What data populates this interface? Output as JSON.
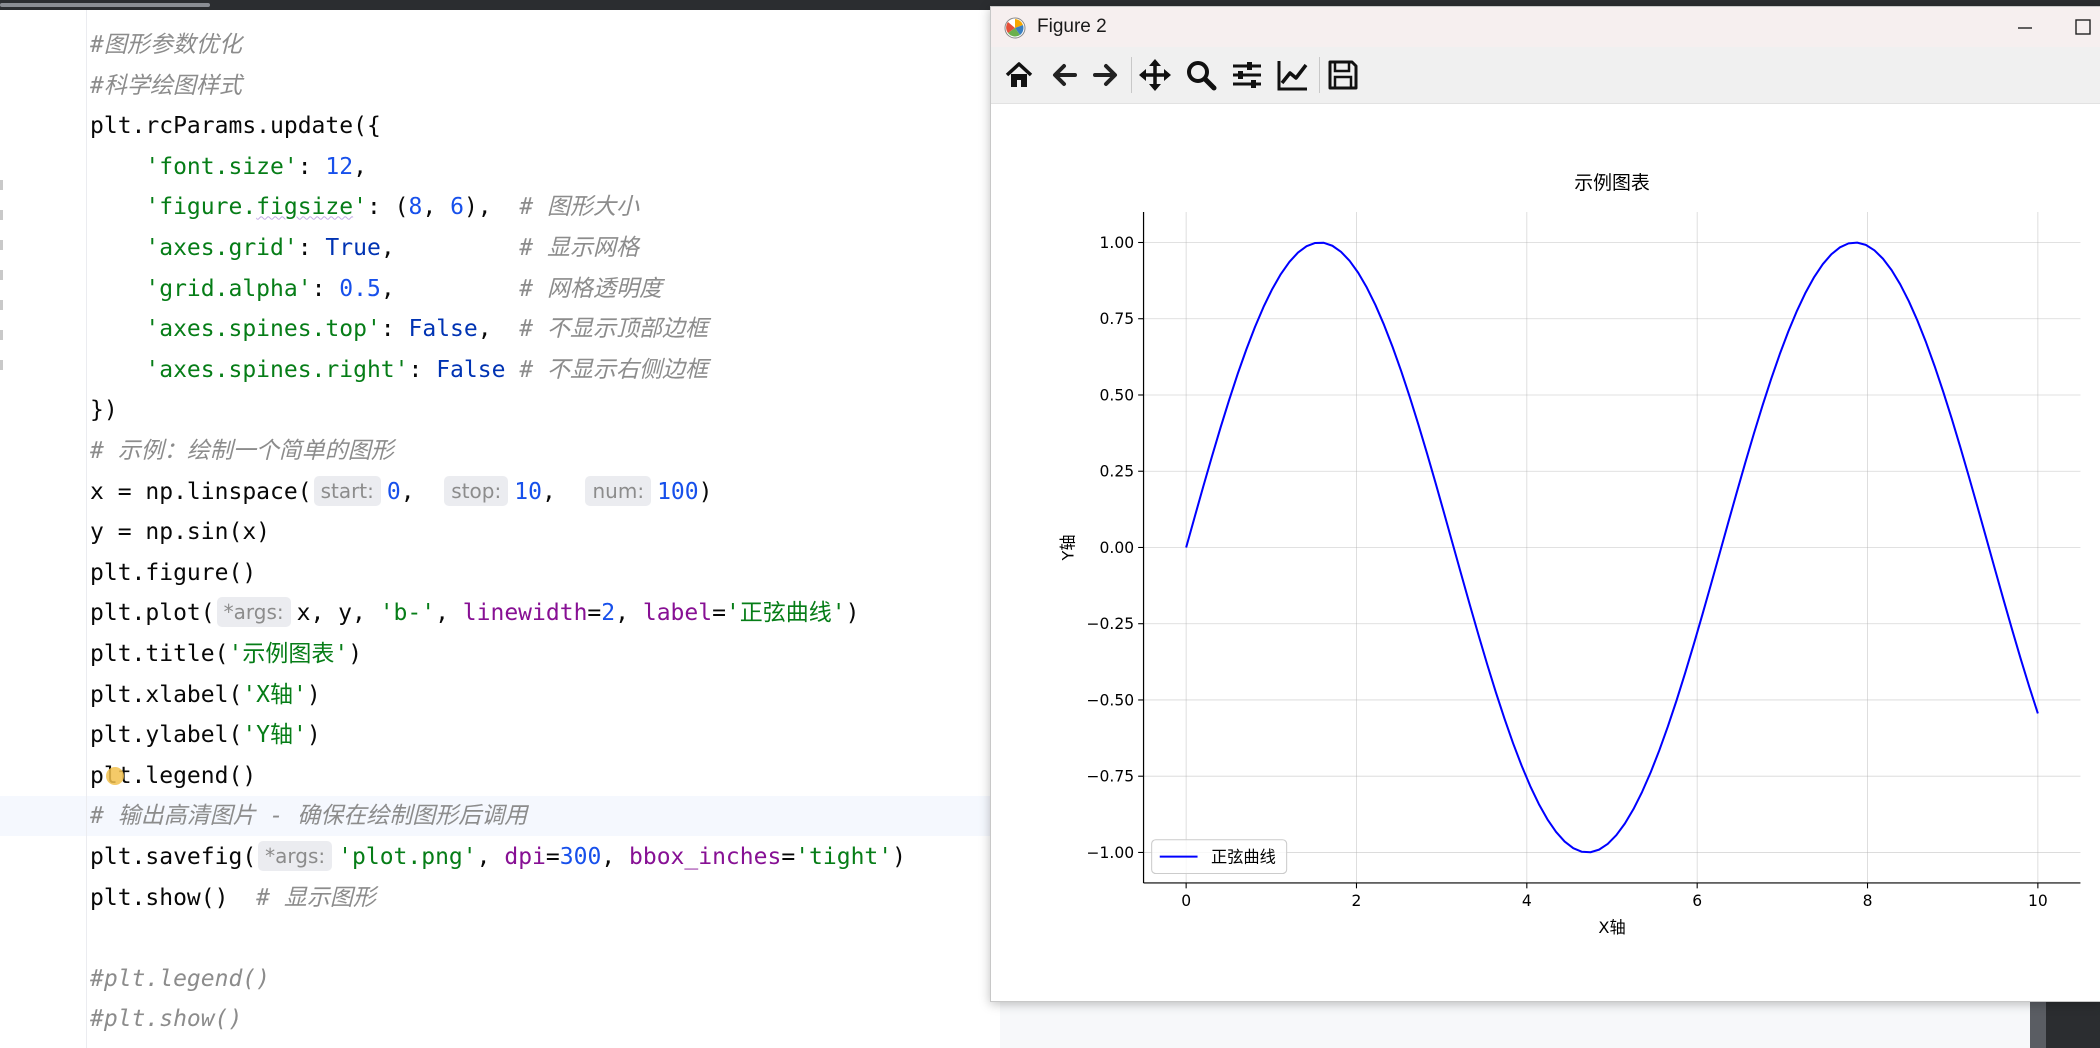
{
  "editor": {
    "code": [
      [
        {
          "t": "#图形参数优化",
          "c": "comment"
        }
      ],
      [
        {
          "t": "#科学绘图样式",
          "c": "comment"
        }
      ],
      [
        {
          "t": "plt.rcParams.update({",
          "c": "plain"
        }
      ],
      [
        {
          "t": "    ",
          "c": "plain"
        },
        {
          "t": "'font.size'",
          "c": "str"
        },
        {
          "t": ": ",
          "c": "plain"
        },
        {
          "t": "12",
          "c": "num"
        },
        {
          "t": ",",
          "c": "plain"
        }
      ],
      [
        {
          "t": "    ",
          "c": "plain"
        },
        {
          "t": "'figure.",
          "c": "str"
        },
        {
          "t": "figsize",
          "c": "str-squiggle"
        },
        {
          "t": "'",
          "c": "str"
        },
        {
          "t": ": (",
          "c": "plain"
        },
        {
          "t": "8",
          "c": "num"
        },
        {
          "t": ", ",
          "c": "plain"
        },
        {
          "t": "6",
          "c": "num"
        },
        {
          "t": "),  ",
          "c": "plain"
        },
        {
          "t": "# 图形大小",
          "c": "comment"
        }
      ],
      [
        {
          "t": "    ",
          "c": "plain"
        },
        {
          "t": "'axes.grid'",
          "c": "str"
        },
        {
          "t": ": ",
          "c": "plain"
        },
        {
          "t": "True",
          "c": "kw"
        },
        {
          "t": ",         ",
          "c": "plain"
        },
        {
          "t": "# 显示网格",
          "c": "comment"
        }
      ],
      [
        {
          "t": "    ",
          "c": "plain"
        },
        {
          "t": "'grid.alpha'",
          "c": "str"
        },
        {
          "t": ": ",
          "c": "plain"
        },
        {
          "t": "0.5",
          "c": "num"
        },
        {
          "t": ",         ",
          "c": "plain"
        },
        {
          "t": "# 网格透明度",
          "c": "comment"
        }
      ],
      [
        {
          "t": "    ",
          "c": "plain"
        },
        {
          "t": "'axes.spines.top'",
          "c": "str"
        },
        {
          "t": ": ",
          "c": "plain"
        },
        {
          "t": "False",
          "c": "kw"
        },
        {
          "t": ",  ",
          "c": "plain"
        },
        {
          "t": "# 不显示顶部边框",
          "c": "comment"
        }
      ],
      [
        {
          "t": "    ",
          "c": "plain"
        },
        {
          "t": "'axes.spines.right'",
          "c": "str"
        },
        {
          "t": ": ",
          "c": "plain"
        },
        {
          "t": "False",
          "c": "kw"
        },
        {
          "t": " ",
          "c": "plain"
        },
        {
          "t": "# 不显示右侧边框",
          "c": "comment"
        }
      ],
      [
        {
          "t": "})",
          "c": "plain"
        }
      ],
      [
        {
          "t": "# 示例：绘制一个简单的图形",
          "c": "comment"
        }
      ],
      [
        {
          "t": "x = np.linspace(",
          "c": "plain"
        },
        {
          "t": "start:",
          "c": "hint"
        },
        {
          "t": "0",
          "c": "num"
        },
        {
          "t": ",  ",
          "c": "plain"
        },
        {
          "t": "stop:",
          "c": "hint"
        },
        {
          "t": "10",
          "c": "num"
        },
        {
          "t": ",  ",
          "c": "plain"
        },
        {
          "t": "num:",
          "c": "hint"
        },
        {
          "t": "100",
          "c": "num"
        },
        {
          "t": ")",
          "c": "plain"
        }
      ],
      [
        {
          "t": "y = np.sin(x)",
          "c": "plain"
        }
      ],
      [
        {
          "t": "plt.figure()",
          "c": "plain"
        }
      ],
      [
        {
          "t": "plt.plot(",
          "c": "plain"
        },
        {
          "t": "*args:",
          "c": "hint"
        },
        {
          "t": "x, y, ",
          "c": "plain"
        },
        {
          "t": "'b-'",
          "c": "str"
        },
        {
          "t": ", ",
          "c": "plain"
        },
        {
          "t": "linewidth",
          "c": "param"
        },
        {
          "t": "=",
          "c": "plain"
        },
        {
          "t": "2",
          "c": "num"
        },
        {
          "t": ", ",
          "c": "plain"
        },
        {
          "t": "label",
          "c": "param"
        },
        {
          "t": "=",
          "c": "plain"
        },
        {
          "t": "'正弦曲线'",
          "c": "str"
        },
        {
          "t": ")",
          "c": "plain"
        }
      ],
      [
        {
          "t": "plt.title(",
          "c": "plain"
        },
        {
          "t": "'示例图表'",
          "c": "str"
        },
        {
          "t": ")",
          "c": "plain"
        }
      ],
      [
        {
          "t": "plt.xlabel(",
          "c": "plain"
        },
        {
          "t": "'X轴'",
          "c": "str"
        },
        {
          "t": ")",
          "c": "plain"
        }
      ],
      [
        {
          "t": "plt.ylabel(",
          "c": "plain"
        },
        {
          "t": "'Y轴'",
          "c": "str"
        },
        {
          "t": ")",
          "c": "plain"
        }
      ],
      [
        {
          "t": "plt.legend()",
          "c": "plain"
        }
      ],
      [
        {
          "t": "# 输出高清图片 - 确保在绘制图形后调用",
          "c": "comment"
        }
      ],
      [
        {
          "t": "plt.savefig(",
          "c": "plain"
        },
        {
          "t": "*args:",
          "c": "hint"
        },
        {
          "t": "'plot.png'",
          "c": "str"
        },
        {
          "t": ", ",
          "c": "plain"
        },
        {
          "t": "dpi",
          "c": "param"
        },
        {
          "t": "=",
          "c": "plain"
        },
        {
          "t": "300",
          "c": "num"
        },
        {
          "t": ", ",
          "c": "plain"
        },
        {
          "t": "bbox_inches",
          "c": "param"
        },
        {
          "t": "=",
          "c": "plain"
        },
        {
          "t": "'tight'",
          "c": "str"
        },
        {
          "t": ")",
          "c": "plain"
        }
      ],
      [
        {
          "t": "plt.show()  ",
          "c": "plain"
        },
        {
          "t": "# 显示图形",
          "c": "comment"
        }
      ],
      [],
      [
        {
          "t": "#plt.legend()",
          "c": "comment"
        }
      ],
      [
        {
          "t": "#plt.show()",
          "c": "comment"
        }
      ]
    ],
    "current_line_index": 19
  },
  "figure_window": {
    "title": "Figure 2",
    "toolbar": [
      {
        "name": "home-icon",
        "tooltip": ""
      },
      {
        "name": "back-arrow-icon",
        "tooltip": ""
      },
      {
        "name": "forward-arrow-icon",
        "tooltip": ""
      },
      {
        "name": "pan-icon",
        "tooltip": ""
      },
      {
        "name": "zoom-icon",
        "tooltip": ""
      },
      {
        "name": "subplots-config-icon",
        "tooltip": ""
      },
      {
        "name": "edit-curve-icon",
        "tooltip": ""
      },
      {
        "name": "save-icon",
        "tooltip": ""
      }
    ]
  },
  "chart_data": {
    "type": "line",
    "title": "示例图表",
    "xlabel": "X轴",
    "ylabel": "Y轴",
    "xlim": [
      -0.5,
      10.5
    ],
    "ylim": [
      -1.1,
      1.1
    ],
    "xticks": [
      0,
      2,
      4,
      6,
      8,
      10
    ],
    "xtick_labels": [
      "0",
      "2",
      "4",
      "6",
      "8",
      "10"
    ],
    "yticks": [
      1.0,
      0.75,
      0.5,
      0.25,
      0.0,
      -0.25,
      -0.5,
      -0.75,
      -1.0
    ],
    "ytick_labels": [
      "1.00",
      "0.75",
      "0.50",
      "0.25",
      "0.00",
      "−0.25",
      "−0.50",
      "−0.75",
      "−1.00"
    ],
    "grid": true,
    "legend_position": "lower-left",
    "series": [
      {
        "name": "正弦曲线",
        "color": "#0000ff",
        "function": "sin",
        "x_start": 0,
        "x_stop": 10,
        "num_points": 100
      }
    ]
  }
}
